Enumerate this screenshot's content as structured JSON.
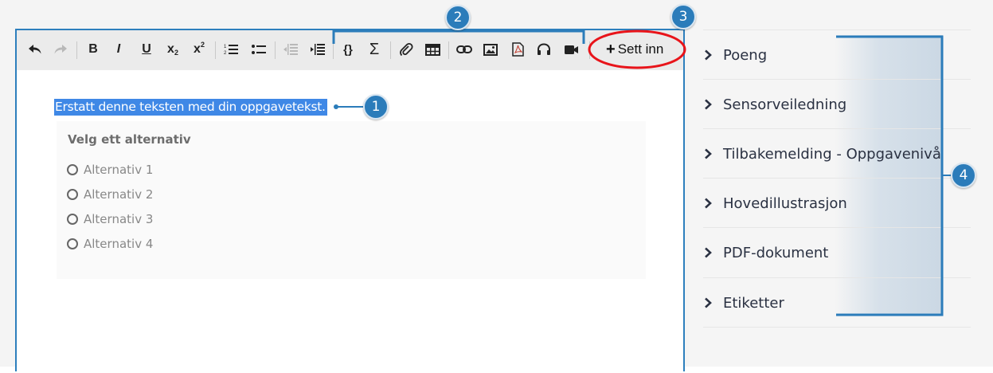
{
  "toolbar": {
    "buttons": [
      {
        "name": "undo-icon",
        "enabled": true
      },
      {
        "name": "redo-icon",
        "enabled": false
      },
      {
        "name": "bold-icon",
        "glyph": "B"
      },
      {
        "name": "italic-icon",
        "glyph": "I"
      },
      {
        "name": "underline-icon",
        "glyph": "U"
      },
      {
        "name": "subscript-icon",
        "glyph": "x₂"
      },
      {
        "name": "superscript-icon",
        "glyph": "x²"
      },
      {
        "name": "ordered-list-icon"
      },
      {
        "name": "bullet-list-icon"
      },
      {
        "name": "outdent-icon",
        "enabled": false
      },
      {
        "name": "indent-icon"
      },
      {
        "name": "code-icon",
        "glyph": "{}"
      },
      {
        "name": "sum-icon",
        "glyph": "Σ"
      },
      {
        "name": "paperclip-icon"
      },
      {
        "name": "table-icon"
      },
      {
        "name": "link-icon"
      },
      {
        "name": "image-icon"
      },
      {
        "name": "pdf-icon"
      },
      {
        "name": "headphones-icon"
      },
      {
        "name": "video-camera-icon"
      }
    ],
    "insert_label": "Sett inn"
  },
  "editor": {
    "task_text": "Erstatt denne teksten med din oppgavetekst.",
    "choice_title": "Velg ett alternativ",
    "options": [
      "Alternativ 1",
      "Alternativ 2",
      "Alternativ 3",
      "Alternativ 4"
    ]
  },
  "sidebar": {
    "items": [
      "Poeng",
      "Sensorveiledning",
      "Tilbakemelding - Oppgavenivå",
      "Hovedillustrasjon",
      "PDF-dokument",
      "Etiketter"
    ]
  },
  "callouts": [
    "1",
    "2",
    "3",
    "4"
  ],
  "colors": {
    "accent": "#2d7fbd",
    "callout": "#2b7cba",
    "selection": "#3f88e6",
    "highlight_ring": "#e8141a"
  }
}
